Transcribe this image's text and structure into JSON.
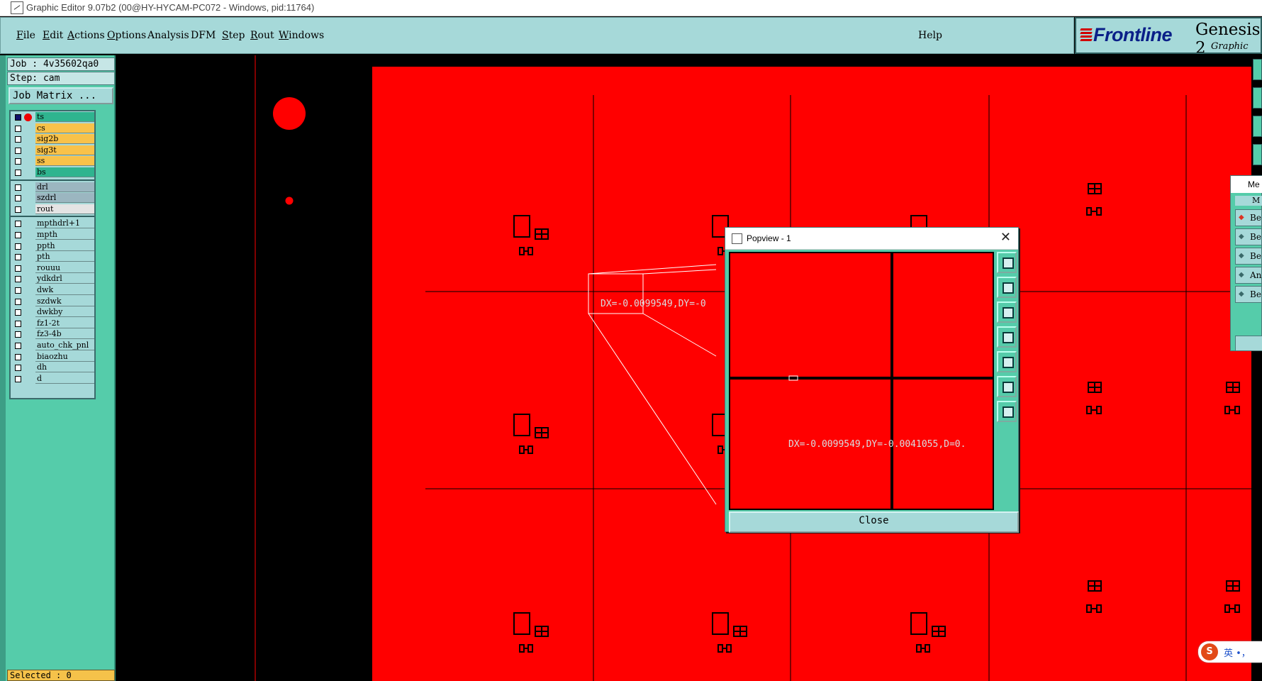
{
  "window": {
    "title": "Graphic Editor 9.07b2 (00@HY-HYCAM-PC072 - Windows, pid:11764)"
  },
  "menubar": {
    "items": [
      {
        "key": "F",
        "rest": "ile"
      },
      {
        "key": "E",
        "rest": "dit"
      },
      {
        "key": "A",
        "rest": "ctions"
      },
      {
        "key": "O",
        "rest": "ptions"
      },
      {
        "key": "",
        "rest": "Analysis"
      },
      {
        "key": "",
        "rest": "DFM"
      },
      {
        "key": "S",
        "rest": "tep"
      },
      {
        "key": "R",
        "rest": "out"
      },
      {
        "key": "W",
        "rest": "indows"
      }
    ],
    "help": "Help"
  },
  "logo": {
    "brand": "Frontline",
    "product": "Genesis 2",
    "subtitle": "Graphic Editor"
  },
  "panel": {
    "job": "Job : 4v35602qa0",
    "step": "Step: cam",
    "job_matrix": "Job Matrix ...",
    "selected": "Selected : 0",
    "groups": [
      [
        {
          "name": "ts",
          "color": "#2fb48f",
          "active": true
        },
        {
          "name": "cs",
          "color": "#f8c24a"
        },
        {
          "name": "sig2b",
          "color": "#f8c24a"
        },
        {
          "name": "sig3t",
          "color": "#f8c24a"
        },
        {
          "name": "ss",
          "color": "#f8c24a"
        },
        {
          "name": "bs",
          "color": "#2fb48f"
        }
      ],
      [
        {
          "name": "drl",
          "color": "#9bb6c0"
        },
        {
          "name": "szdrl",
          "color": "#9bb6c0"
        },
        {
          "name": "rout",
          "color": "#e4e4e4"
        }
      ],
      [
        {
          "name": "mpthdrl+1",
          "color": "#a6d9d9"
        },
        {
          "name": "mpth",
          "color": "#a6d9d9"
        },
        {
          "name": "ppth",
          "color": "#a6d9d9"
        },
        {
          "name": "pth",
          "color": "#a6d9d9"
        },
        {
          "name": "rouuu",
          "color": "#a6d9d9"
        },
        {
          "name": "ydkdrl",
          "color": "#a6d9d9"
        },
        {
          "name": "dwk",
          "color": "#a6d9d9"
        },
        {
          "name": "szdwk",
          "color": "#a6d9d9"
        },
        {
          "name": "dwkby",
          "color": "#a6d9d9"
        },
        {
          "name": "fz1-2t",
          "color": "#a6d9d9"
        },
        {
          "name": "fz3-4b",
          "color": "#a6d9d9"
        },
        {
          "name": "auto_chk_pnl",
          "color": "#a6d9d9"
        },
        {
          "name": "biaozhu",
          "color": "#a6d9d9"
        },
        {
          "name": "dh",
          "color": "#a6d9d9"
        },
        {
          "name": "d",
          "color": "#a6d9d9"
        }
      ]
    ]
  },
  "canvas": {
    "measure_text": "DX=-0.0099549,DY=-0.0041055,D=0.",
    "measure_text_clipped": "DX=-0.0099549,DY=-0"
  },
  "popview": {
    "title": "Popview - 1",
    "close_label": "Close",
    "measure_text": "DX=-0.0099549,DY=-0.0041055,D=0."
  },
  "right_panel": {
    "title": "Me",
    "header": "M",
    "items": [
      "Be",
      "Be",
      "Be",
      "An",
      "Be"
    ]
  },
  "ime": {
    "badge": "S",
    "text": "英 •，"
  },
  "colors": {
    "board": "#ff0000",
    "panel": "#55ccaa",
    "menubar": "#a6d9d9",
    "accent_layer": "#f8c24a"
  }
}
